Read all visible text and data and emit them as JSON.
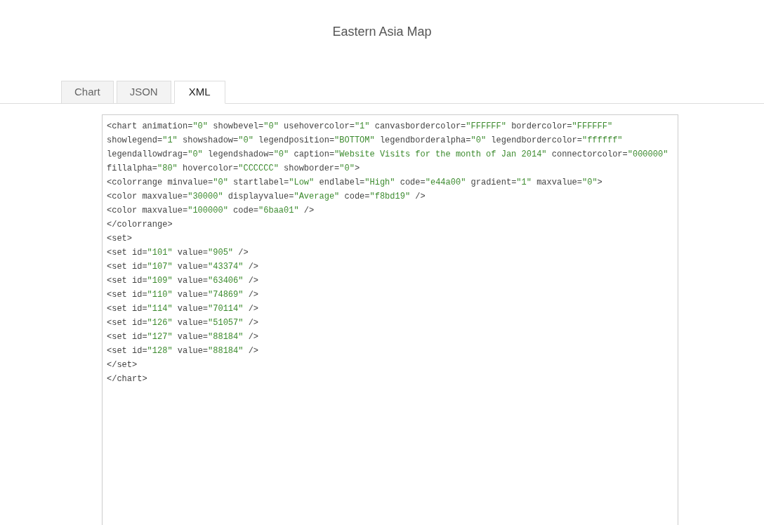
{
  "title": "Eastern Asia Map",
  "tabs": [
    {
      "label": "Chart",
      "selected": false
    },
    {
      "label": "JSON",
      "selected": false
    },
    {
      "label": "XML",
      "selected": true
    }
  ],
  "code_lines": [
    "<chart animation=\"0\" showbevel=\"0\" usehovercolor=\"1\" canvasbordercolor=\"FFFFFF\" bordercolor=\"FFFFFF\"",
    "showlegend=\"1\" showshadow=\"0\" legendposition=\"BOTTOM\" legendborderalpha=\"0\" legendbordercolor=\"ffffff\"",
    "legendallowdrag=\"0\" legendshadow=\"0\" caption=\"Website Visits for the month of Jan 2014\" connectorcolor=\"000000\"",
    "fillalpha=\"80\" hovercolor=\"CCCCCC\" showborder=\"0\">",
    "<colorrange minvalue=\"0\" startlabel=\"Low\" endlabel=\"High\" code=\"e44a00\" gradient=\"1\" maxvalue=\"0\">",
    "<color maxvalue=\"30000\" displayvalue=\"Average\" code=\"f8bd19\" />",
    "<color maxvalue=\"100000\" code=\"6baa01\" />",
    "</colorrange>",
    "<set>",
    "<set id=\"101\" value=\"905\" />",
    "<set id=\"107\" value=\"43374\" />",
    "<set id=\"109\" value=\"63406\" />",
    "<set id=\"110\" value=\"74869\" />",
    "<set id=\"114\" value=\"70114\" />",
    "<set id=\"126\" value=\"51057\" />",
    "<set id=\"127\" value=\"88184\" />",
    "<set id=\"128\" value=\"88184\" />",
    "</set>",
    "</chart>"
  ]
}
